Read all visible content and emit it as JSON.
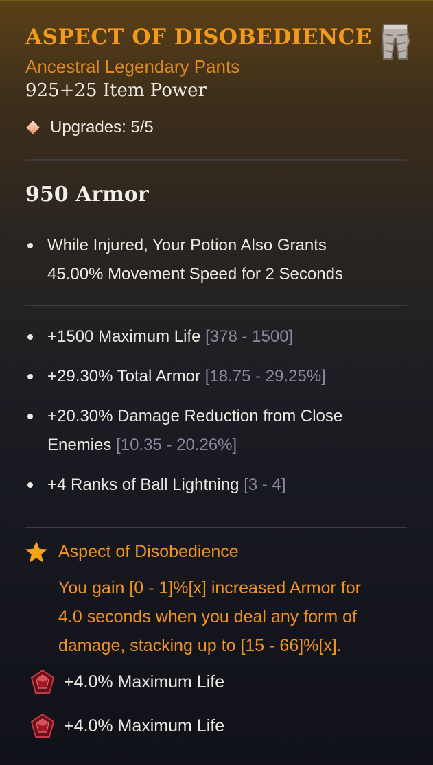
{
  "item": {
    "name": "ASPECT OF DISOBEDIENCE",
    "type": "Ancestral Legendary Pants",
    "item_power": "925+25 Item Power",
    "upgrades": "Upgrades: 5/5",
    "icon": "pants-icon"
  },
  "armor": "950 Armor",
  "implicit": [
    {
      "line1": "While Injured, Your Potion Also Grants",
      "line2": "45.00% Movement Speed for 2 Seconds"
    }
  ],
  "affixes": [
    {
      "text": "+1500 Maximum Life",
      "range": "[378 - 1500]"
    },
    {
      "text": "+29.30% Total Armor",
      "range": "[18.75 - 29.25%]"
    },
    {
      "text": "+20.30% Damage Reduction from Close",
      "text2": "Enemies",
      "range": "[10.35 - 20.26%]"
    },
    {
      "text": "+4 Ranks of Ball Lightning",
      "range": "[3 - 4]"
    }
  ],
  "aspect": {
    "icon": "star-icon",
    "title": "Aspect of Disobedience",
    "line1": "You gain [0 - 1]%[x] increased Armor for",
    "line2": "4.0 seconds when you deal any form of",
    "line3": "damage, stacking up to [15 - 66]%[x]."
  },
  "sockets": [
    {
      "icon": "ruby-gem-icon",
      "text": "+4.0% Maximum Life"
    },
    {
      "icon": "ruby-gem-icon",
      "text": "+4.0% Maximum Life"
    }
  ],
  "colors": {
    "legendary": "#f39a1a",
    "range": "#8a88a0",
    "text": "#ece8e2"
  }
}
